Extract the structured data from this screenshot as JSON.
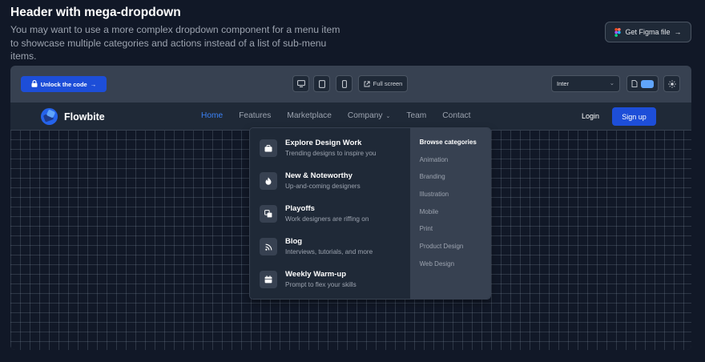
{
  "header": {
    "title": "Header with mega-dropdown",
    "description": "You may want to use a more complex dropdown component for a menu item to showcase multiple categories and actions instead of a list of sub-menu items.",
    "figma_label": "Get Figma file",
    "figma_arrow": "→"
  },
  "toolbar": {
    "unlock_label": "Unlock the code",
    "unlock_arrow": "→",
    "fullscreen_label": "Full screen",
    "font_value": "Inter",
    "font_chevron": "⌄"
  },
  "navbar": {
    "brand": "Flowbite",
    "links": [
      {
        "label": "Home"
      },
      {
        "label": "Features"
      },
      {
        "label": "Marketplace"
      },
      {
        "label": "Company",
        "chevron": "⌄"
      },
      {
        "label": "Team"
      },
      {
        "label": "Contact"
      }
    ],
    "login": "Login",
    "signup": "Sign up"
  },
  "dropdown": {
    "items": [
      {
        "title": "Explore Design Work",
        "desc": "Trending designs to inspire you",
        "icon": "briefcase-icon"
      },
      {
        "title": "New & Noteworthy",
        "desc": "Up-and-coming designers",
        "icon": "fire-icon"
      },
      {
        "title": "Playoffs",
        "desc": "Work designers are riffing on",
        "icon": "copy-icon"
      },
      {
        "title": "Blog",
        "desc": "Interviews, tutorials, and more",
        "icon": "rss-icon"
      },
      {
        "title": "Weekly Warm-up",
        "desc": "Prompt to flex your skills",
        "icon": "calendar-icon"
      }
    ],
    "browse_title": "Browse categories",
    "categories": [
      "Animation",
      "Branding",
      "Illustration",
      "Mobile",
      "Print",
      "Product Design",
      "Web Design"
    ]
  },
  "colors": {
    "accent": "#1d4ed8",
    "active_link": "#3b82f6",
    "background": "#111827",
    "panel": "#1f2937"
  }
}
